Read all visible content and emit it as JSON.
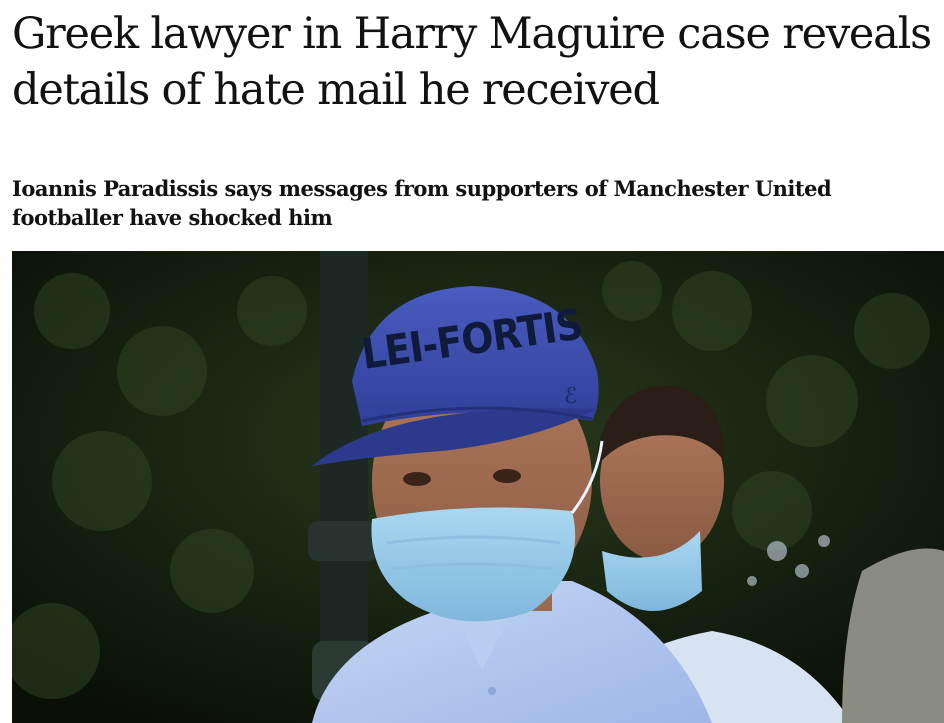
{
  "article": {
    "headline": "Greek lawyer in Harry Maguire case reveals details of hate mail he received",
    "standfirst": "Ioannis Paradissis says messages from supporters of Manchester United footballer have shocked him",
    "image": {
      "cap_text": "LEI-FORTIS"
    }
  }
}
